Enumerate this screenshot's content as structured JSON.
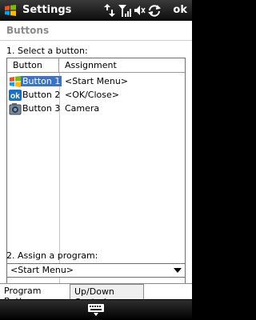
{
  "titlebar": {
    "title": "Settings",
    "ok_label": "ok",
    "icons": [
      "start-flag-icon",
      "data-arrows-icon",
      "signal-icon",
      "volume-icon",
      "sync-icon"
    ]
  },
  "page": {
    "header": "Buttons"
  },
  "select_label": "1. Select a button:",
  "list": {
    "columns": [
      "Button",
      "Assignment"
    ],
    "rows": [
      {
        "button": "Button 1",
        "assignment": "<Start Menu>",
        "icon": "windows-flag-icon",
        "selected": true
      },
      {
        "button": "Button 2",
        "assignment": "<OK/Close>",
        "icon": "ok-icon",
        "selected": false
      },
      {
        "button": "Button 3",
        "assignment": "Camera",
        "icon": "camera-icon",
        "selected": false
      }
    ]
  },
  "assign_label": "2. Assign a program:",
  "program_select": {
    "value": "<Start Menu>"
  },
  "tabs": [
    "Program Buttons",
    "Up/Down Control"
  ],
  "active_tab": "Program Buttons",
  "bottombar": {
    "icon": "keyboard-icon"
  },
  "colors": {
    "selection": "#3b73c5",
    "titlebar": "#1a1a1a"
  }
}
